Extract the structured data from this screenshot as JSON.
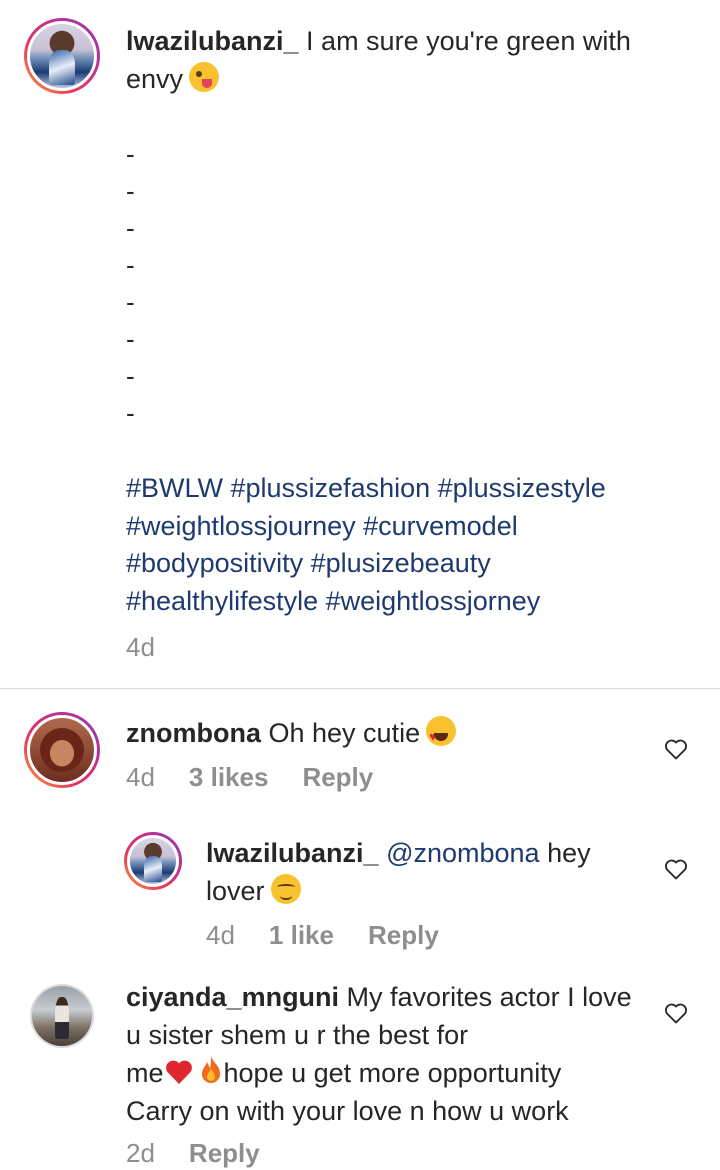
{
  "post": {
    "username": "lwazilubanzi_",
    "caption_line1": " I am sure you're green with",
    "caption_line2": "envy",
    "dashes": [
      "-",
      "-",
      "-",
      "-",
      "-",
      "-",
      "-",
      "-"
    ],
    "hashtag_lines": [
      "#BWLW #plussizefashion #plussizestyle",
      "#weightlossjourney #curvemodel",
      "#bodypositivity #plusizebeauty",
      "#healthylifestyle #weightlossjorney"
    ],
    "time": "4d"
  },
  "comments": [
    {
      "username": "znombona",
      "text": " Oh hey cutie",
      "time": "4d",
      "likes": "3 likes",
      "reply": "Reply"
    },
    {
      "username": "lwazilubanzi_",
      "mention": "@znombona",
      "text_line1": " hey",
      "text_line2": "lover",
      "time": "4d",
      "likes": "1 like",
      "reply": "Reply"
    },
    {
      "username": "ciyanda_mnguni",
      "text_line1": " My favorites actor I love",
      "text_line2": "u sister shem u r the best for",
      "text_line3a": "me",
      "text_line3b": "hope u get more opportunity",
      "text_line4": "Carry on with your love n how u work",
      "time": "2d",
      "reply": "Reply"
    }
  ],
  "icons": {
    "like": "heart-outline-icon",
    "emoji_wink": "winking-face-tongue-emoji",
    "emoji_hearteyes": "heart-eyes-emoji",
    "emoji_blush": "smiling-face-emoji",
    "emoji_heart": "red-heart-emoji",
    "emoji_fire": "fire-emoji"
  },
  "colors": {
    "text": "#262626",
    "meta": "#8e8e8e",
    "hashtag": "#1e3a6e",
    "divider": "#dbdbdb"
  }
}
